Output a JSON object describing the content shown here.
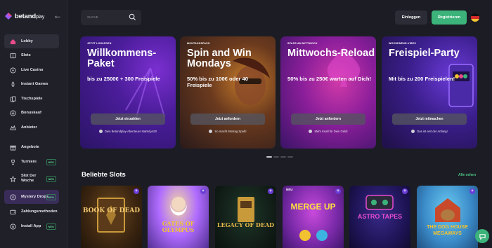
{
  "brand": {
    "name_main": "betand",
    "name_accent": "play"
  },
  "sidebar": {
    "items": [
      {
        "label": "Lobby",
        "icon": "house-icon"
      },
      {
        "label": "Slots",
        "icon": "slot-machine-icon"
      },
      {
        "label": "Live Casino",
        "icon": "dice-icon"
      },
      {
        "label": "Instant Games",
        "icon": "rocket-icon"
      },
      {
        "label": "Tischspiele",
        "icon": "cards-icon"
      },
      {
        "label": "Bonuskauf",
        "icon": "bonus-icon"
      },
      {
        "label": "Anbieter",
        "icon": "provider-icon"
      },
      {
        "label": "Angebote",
        "icon": "gift-icon"
      },
      {
        "label": "Turniere",
        "icon": "trophy-icon",
        "badge": "NEU"
      },
      {
        "label": "Slot Der Woche",
        "icon": "star-slot-icon",
        "badge": "NEU"
      },
      {
        "label": "Mystery Drops",
        "icon": "mystery-drops-icon",
        "badge": "NEU"
      },
      {
        "label": "Zahlungsmethoden",
        "icon": "wallet-icon"
      },
      {
        "label": "Install App",
        "icon": "download-icon",
        "badge": "NEU"
      }
    ]
  },
  "header": {
    "search_placeholder": "SUCHE",
    "login_label": "Einloggen",
    "register_label": "Registrieren",
    "language": "DE"
  },
  "promos": [
    {
      "tag": "JETZT LOSLEGEN",
      "title": "Willkommens-Paket",
      "subtitle": "bis zu 2500€ + 300 Freispiele",
      "button": "Jetzt einzahlen",
      "note": "Dein Betandplay-Abenteuer startet jetzt!"
    },
    {
      "tag": "MONTAGSSPASS",
      "title": "Spin and Win Mondays",
      "subtitle": "50% bis zu 100€ oder 40 Freispiele",
      "button": "Jetzt anfordern",
      "note": "So macht Montag Spaß!"
    },
    {
      "tag": "SPASS AM MITTWOCH",
      "title": "Mittwochs-Reload",
      "subtitle": "50% bis zu 250€ warten auf Dich!",
      "button": "Jetzt anfordern",
      "note": "Mehr Knall für Dein Geld!"
    },
    {
      "tag": "WOCHENEND-VIBES",
      "title": "Freispiel-Party",
      "subtitle": "Mit bis zu 200 Freispielen!",
      "button": "Jetzt mitmachen",
      "note": "Das ist erst der Anfang!"
    }
  ],
  "carousel": {
    "pages": 4,
    "active": 1
  },
  "popular": {
    "title": "Beliebte Slots",
    "see_all": "Alle sehen",
    "games": [
      {
        "name": "BOOK OF DEAD",
        "badge": "+"
      },
      {
        "name": "GATES OF OLYMPUS",
        "badge": "+"
      },
      {
        "name": "LEGACY OF DEAD",
        "badge": "+"
      },
      {
        "name": "MERGE UP",
        "tag": "NEU",
        "badge": "+"
      },
      {
        "name": "ASTRO TAPES",
        "badge": "+"
      },
      {
        "name": "THE DOG HOUSE MEGAWAYS",
        "badge": "+"
      }
    ]
  }
}
